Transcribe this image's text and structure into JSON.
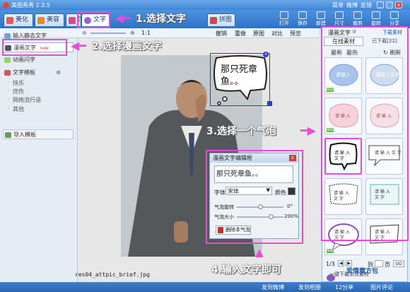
{
  "app": {
    "title": "美图秀秀 2.3.5"
  },
  "titlebar_menu": [
    "菜单",
    "微博",
    "反馈"
  ],
  "tabs": [
    {
      "label": "美化",
      "color": "#e75a54"
    },
    {
      "label": "美容",
      "color": "#e38b2b"
    },
    {
      "label": "饰品",
      "color": "#d64a8f"
    },
    {
      "label": "文字",
      "color": "#9b5fd1"
    },
    {
      "label": "拼图",
      "color": "#cc4a49"
    }
  ],
  "tools": [
    "打开",
    "保存",
    "新建",
    "尺寸",
    "裁剪",
    "旋转",
    "分享"
  ],
  "subbar": {
    "zoom_ratio": "1:1",
    "actions": [
      "撤销",
      "重做",
      "原图",
      "对比",
      "预览"
    ]
  },
  "left_panel": {
    "top_item": "输入静态文字",
    "comic_text": "漫画文字",
    "comic_badge": "new",
    "animated": "动画闪字",
    "templates": "文字模板",
    "template_items": [
      "快乐",
      "优伤",
      "网络流行语",
      "其他"
    ],
    "import": "导入模板"
  },
  "canvas": {
    "bubble_text": "那只死章鱼。。",
    "filename": "res04_attpic_brief.jpg"
  },
  "dialog": {
    "title": "漫画文字编辑框",
    "text_value": "那只死章鱼。。",
    "font_label": "字体",
    "font_value": "宋体",
    "color_label": "颜色",
    "rotate_label": "气泡旋转",
    "rotate_value": "0°",
    "size_label": "气泡大小",
    "size_value": "200%",
    "rotate_level": 0.5,
    "size_level": 0.72,
    "delete_label": "删除本气泡"
  },
  "right_panel": {
    "title": "漫画文字",
    "download_link": "下载素材",
    "tab_online": "在线素材",
    "tab_downloaded": "已下载[22]",
    "sort_new": "最新",
    "sort_hot": "最热",
    "refresh": "刷新",
    "bubble_label": "请输入文字",
    "page_info": "1/3",
    "page_goto": "到",
    "page_suffix": "页",
    "page_go": "GO",
    "download_all": "一键下载本页素材",
    "ad_text": "爱情魔方包"
  },
  "annotations": {
    "step1": "1.选择文字",
    "step2": "2.选择漫画文字",
    "step3": "3.选择一个气泡",
    "step4": "4.输入文字即可"
  },
  "statusbar": {
    "items": [
      "发到微博",
      "发到相册",
      "12分享",
      "图片评论"
    ]
  }
}
